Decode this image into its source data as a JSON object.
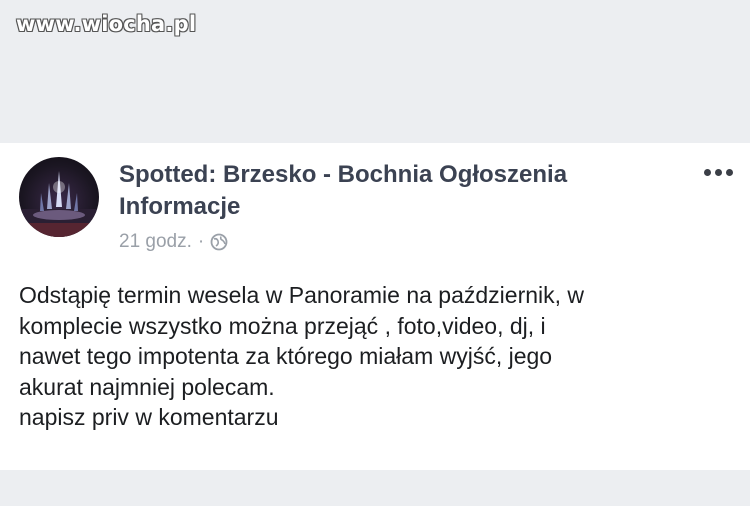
{
  "watermark": {
    "text": "www.wiocha.pl"
  },
  "post": {
    "page_name": "Spotted: Brzesko - Bochnia Ogłoszenia Informacje",
    "timestamp": "21 godz.",
    "separator": "·",
    "privacy_icon": "globe-icon",
    "more_icon": "more-options-icon",
    "body_lines": [
      "Odstąpię termin wesela w Panoramie na październik, w",
      "komplecie wszystko można przejąć , foto,video, dj, i",
      "nawet tego impotenta za którego miałam wyjść, jego",
      "akurat najmniej polecam.",
      "napisz priv w komentarzu"
    ]
  }
}
